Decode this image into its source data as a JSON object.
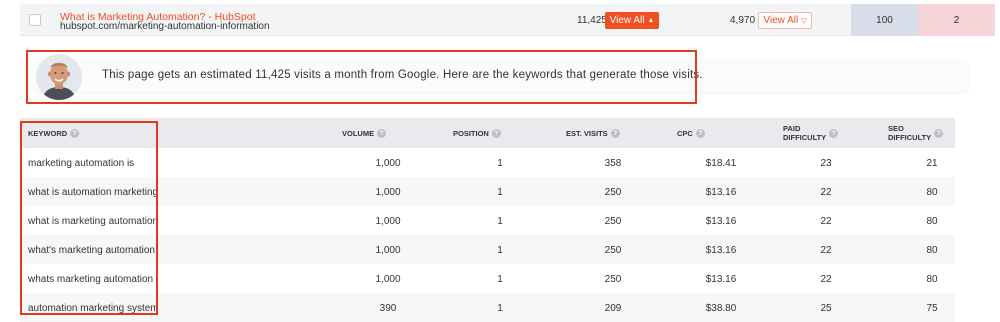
{
  "top_result": {
    "title": "What is Marketing Automation? - HubSpot",
    "url": "hubspot.com/marketing-automation-information",
    "est_visits": "11,425",
    "view_all_primary": "View All",
    "backlinks": "4,970",
    "view_all_secondary": "View All",
    "domain_score": "100",
    "top_value": "2"
  },
  "info": {
    "text": "This page gets an estimated 11,425 visits a month from Google. Here are the keywords that generate those visits."
  },
  "table": {
    "headers": {
      "keyword": "KEYWORD",
      "volume": "VOLUME",
      "position": "POSITION",
      "est_visits": "EST. VISITS",
      "cpc": "CPC",
      "paid_difficulty_1": "PAID",
      "paid_difficulty_2": "DIFFICULTY",
      "seo_difficulty_1": "SEO",
      "seo_difficulty_2": "DIFFICULTY"
    },
    "rows": [
      {
        "keyword": "marketing automation is",
        "volume": "1,000",
        "position": "1",
        "visits": "358",
        "cpc": "$18.41",
        "paid": "23",
        "seo": "21"
      },
      {
        "keyword": "what is automation marketing",
        "volume": "1,000",
        "position": "1",
        "visits": "250",
        "cpc": "$13.16",
        "paid": "22",
        "seo": "80"
      },
      {
        "keyword": "what is marketing automation",
        "volume": "1,000",
        "position": "1",
        "visits": "250",
        "cpc": "$13.16",
        "paid": "22",
        "seo": "80"
      },
      {
        "keyword": "what's marketing automation",
        "volume": "1,000",
        "position": "1",
        "visits": "250",
        "cpc": "$13.16",
        "paid": "22",
        "seo": "80"
      },
      {
        "keyword": "whats marketing automation",
        "volume": "1,000",
        "position": "1",
        "visits": "250",
        "cpc": "$13.16",
        "paid": "22",
        "seo": "80"
      },
      {
        "keyword": "automation marketing system",
        "volume": "390",
        "position": "1",
        "visits": "209",
        "cpc": "$38.80",
        "paid": "25",
        "seo": "75"
      }
    ]
  },
  "colors": {
    "accent": "#f04e23",
    "highlight_outline": "#e03a1e",
    "domain_cell": "#d7dde9",
    "value_cell": "#f5d5d7"
  },
  "icons": [
    "help-icon",
    "chevron-up-icon",
    "chevron-down-icon",
    "avatar"
  ]
}
